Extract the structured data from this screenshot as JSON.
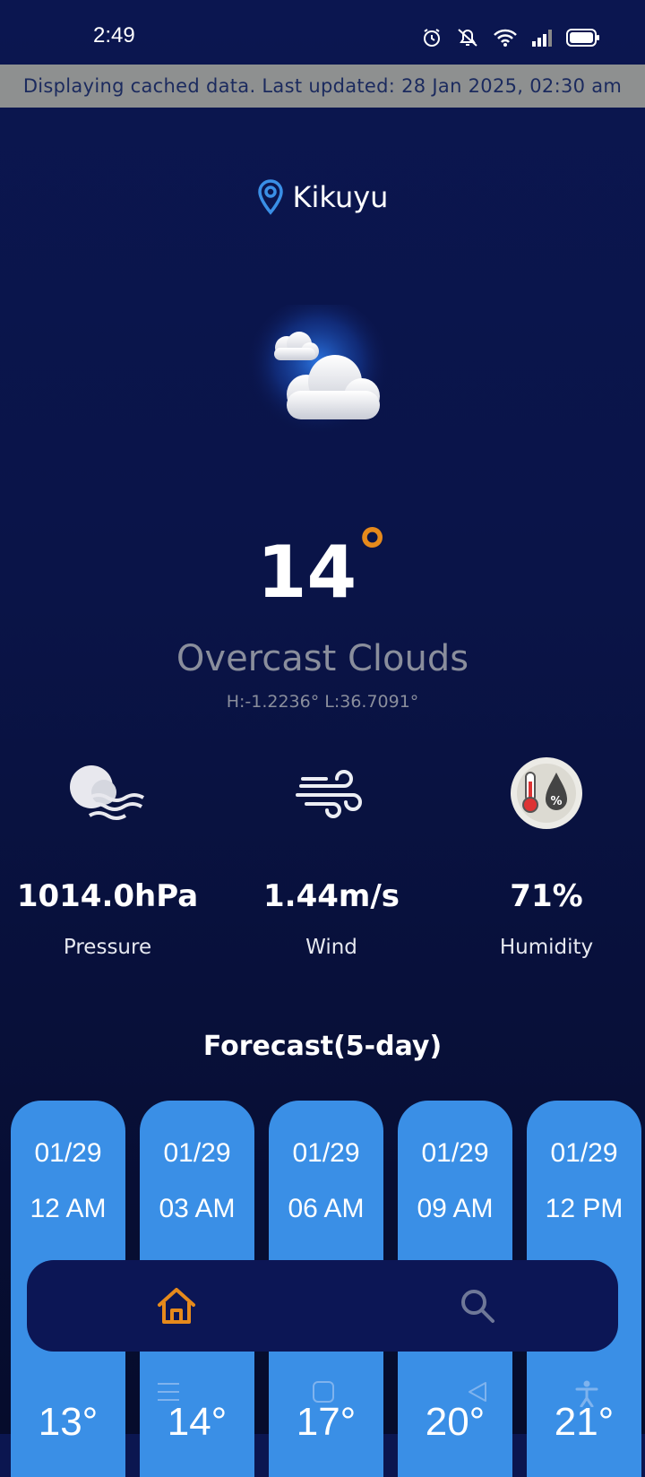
{
  "status_bar": {
    "time": "2:49"
  },
  "banner": {
    "text": "Displaying cached data. Last updated: 28 Jan 2025, 02:30 am"
  },
  "location": {
    "name": "Kikuyu",
    "icon": "map-pin-icon"
  },
  "current": {
    "temperature": "14",
    "degree_symbol": "°",
    "condition": "Overcast Clouds",
    "coords": "H:-1.2236°  L:36.7091°"
  },
  "stats": [
    {
      "value": "1014.0hPa",
      "label": "Pressure",
      "icon": "pressure-fog-icon"
    },
    {
      "value": "1.44m/s",
      "label": "Wind",
      "icon": "wind-icon"
    },
    {
      "value": "71%",
      "label": "Humidity",
      "icon": "humidity-thermometer-icon"
    }
  ],
  "forecast": {
    "title": "Forecast(5-day)",
    "items": [
      {
        "date": "01/29",
        "time": "12 AM",
        "temp": "13°"
      },
      {
        "date": "01/29",
        "time": "03 AM",
        "temp": "14°"
      },
      {
        "date": "01/29",
        "time": "06 AM",
        "temp": "17°"
      },
      {
        "date": "01/29",
        "time": "09 AM",
        "temp": "20°"
      },
      {
        "date": "01/29",
        "time": "12 PM",
        "temp": "21°"
      }
    ]
  },
  "nav": {
    "home_icon": "home-icon",
    "search_icon": "search-icon"
  },
  "colors": {
    "accent": "#e68a1c",
    "card": "#3a8fe6",
    "banner": "#8e9090",
    "background": "#0b1650"
  }
}
